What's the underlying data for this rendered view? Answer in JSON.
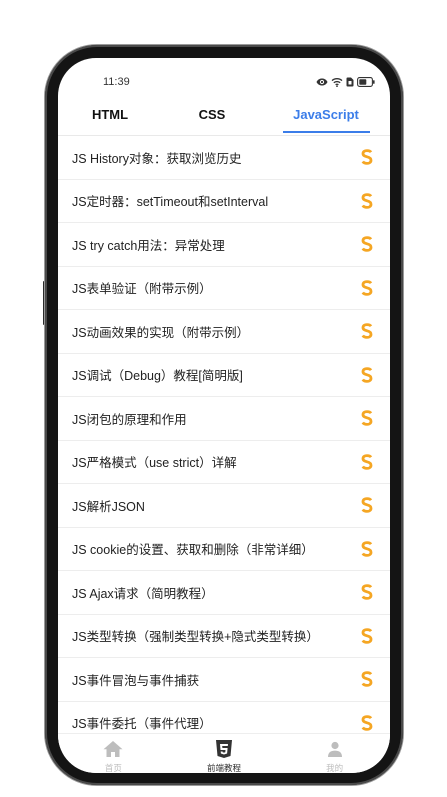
{
  "status_bar": {
    "time": "11:39",
    "icons": [
      "eye-icon",
      "wifi-icon",
      "sim-icon",
      "battery-icon"
    ]
  },
  "tabs": [
    {
      "label": "HTML",
      "active": false
    },
    {
      "label": "CSS",
      "active": false
    },
    {
      "label": "JavaScript",
      "active": true
    }
  ],
  "articles": [
    {
      "title": "JS History对象：获取浏览历史",
      "icon": "s-icon"
    },
    {
      "title": "JS定时器：setTimeout和setInterval",
      "icon": "s-icon"
    },
    {
      "title": "JS try catch用法：异常处理",
      "icon": "s-icon"
    },
    {
      "title": "JS表单验证（附带示例）",
      "icon": "s-icon"
    },
    {
      "title": "JS动画效果的实现（附带示例）",
      "icon": "s-icon"
    },
    {
      "title": "JS调试（Debug）教程[简明版]",
      "icon": "s-icon"
    },
    {
      "title": "JS闭包的原理和作用",
      "icon": "s-icon"
    },
    {
      "title": "JS严格模式（use strict）详解",
      "icon": "s-icon"
    },
    {
      "title": "JS解析JSON",
      "icon": "s-icon"
    },
    {
      "title": "JS cookie的设置、获取和删除（非常详细）",
      "icon": "s-icon"
    },
    {
      "title": "JS Ajax请求（简明教程）",
      "icon": "s-icon"
    },
    {
      "title": "JS类型转换（强制类型转换+隐式类型转换）",
      "icon": "s-icon"
    },
    {
      "title": "JS事件冒泡与事件捕获",
      "icon": "s-icon"
    },
    {
      "title": "JS事件委托（事件代理）",
      "icon": "s-icon"
    }
  ],
  "bottom_nav": [
    {
      "label": "首页",
      "icon": "home-icon",
      "active": false
    },
    {
      "label": "前端教程",
      "icon": "html5-icon",
      "active": true
    },
    {
      "label": "我的",
      "icon": "person-icon",
      "active": false
    }
  ],
  "colors": {
    "accent": "#3b7de9",
    "orange": "#f5a623",
    "text": "#222222",
    "nav_inactive": "#bdbdbd",
    "nav_active": "#333333"
  }
}
